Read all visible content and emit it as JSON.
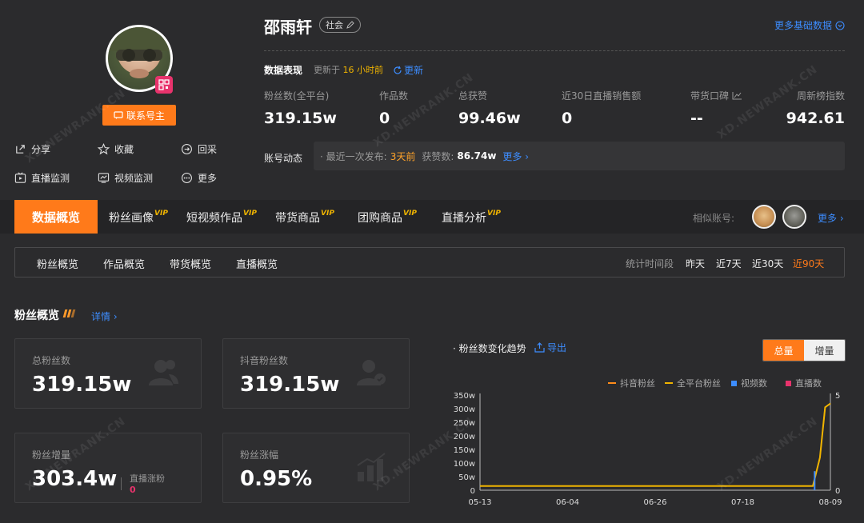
{
  "profile": {
    "name": "邵雨轩",
    "tag": "社会",
    "contact_label": "联系号主",
    "more_basic": "更多基础数据",
    "actions": [
      "分享",
      "收藏",
      "回采",
      "直播监测",
      "视频监测",
      "更多"
    ]
  },
  "performance": {
    "label": "数据表现",
    "updated_prefix": "更新于",
    "updated_time": "16 小时前",
    "refresh": "更新",
    "stats": [
      {
        "label": "粉丝数(全平台)",
        "value": "319.15w"
      },
      {
        "label": "作品数",
        "value": "0"
      },
      {
        "label": "总获赞",
        "value": "99.46w"
      },
      {
        "label": "近30日直播销售额",
        "value": "0"
      },
      {
        "label": "带货口碑",
        "value": "--"
      },
      {
        "label": "周新榜指数",
        "value": "942.61"
      }
    ]
  },
  "dynamics": {
    "label": "账号动态",
    "last_publish_label": "· 最近一次发布:",
    "last_publish": "3天前",
    "likes_label": "获赞数:",
    "likes": "86.74w",
    "more": "更多 ›"
  },
  "tabs": {
    "active": "数据概览",
    "items": [
      {
        "label": "粉丝画像",
        "vip": "VIP"
      },
      {
        "label": "短视频作品",
        "vip": "VIP"
      },
      {
        "label": "带货商品",
        "vip": "VIP"
      },
      {
        "label": "团购商品",
        "vip": "VIP"
      },
      {
        "label": "直播分析",
        "vip": "VIP"
      }
    ],
    "similar_label": "相似账号:",
    "more": "更多 ›"
  },
  "subnav": {
    "items": [
      "粉丝概览",
      "作品概览",
      "带货概览",
      "直播概览"
    ],
    "period_label": "统计时间段",
    "periods": [
      "昨天",
      "近7天",
      "近30天",
      "近90天"
    ],
    "active_period": "近90天"
  },
  "fans": {
    "title": "粉丝概览",
    "detail": "详情 ›",
    "cards": [
      {
        "label": "总粉丝数",
        "value": "319.15w"
      },
      {
        "label": "抖音粉丝数",
        "value": "319.15w"
      },
      {
        "label": "粉丝增量",
        "value": "303.4w",
        "sub_label": "直播涨粉",
        "sub_value": "0"
      },
      {
        "label": "粉丝涨幅",
        "value": "0.95%"
      }
    ]
  },
  "trend": {
    "title": "· 粉丝数变化趋势",
    "export": "导出",
    "toggle": [
      "总量",
      "增量"
    ],
    "legend": [
      {
        "name": "抖音粉丝",
        "color": "#ff8c1a"
      },
      {
        "name": "全平台粉丝",
        "color": "#f0b400"
      },
      {
        "name": "视频数",
        "color": "#3d8dff"
      },
      {
        "name": "直播数",
        "color": "#e8336c"
      }
    ]
  },
  "watermark": "XD.NEWRANK.CN",
  "chart_data": {
    "type": "line",
    "x_ticks": [
      "05-13",
      "06-04",
      "06-26",
      "07-18",
      "08-09"
    ],
    "y_ticks_left": [
      "0",
      "50w",
      "100w",
      "150w",
      "200w",
      "250w",
      "300w",
      "350w"
    ],
    "y_ticks_right": [
      "0",
      "5"
    ],
    "ylim_left": [
      0,
      350
    ],
    "ylim_right": [
      0,
      5
    ],
    "series": [
      {
        "name": "抖音粉丝",
        "color": "#ff8c1a",
        "x": [
          0,
          0.95,
          0.97,
          0.985,
          1.0
        ],
        "values": [
          15.7,
          15.7,
          120,
          305,
          319.15
        ]
      },
      {
        "name": "全平台粉丝",
        "color": "#f0b400",
        "x": [
          0,
          0.95,
          0.97,
          0.985,
          1.0
        ],
        "values": [
          15.7,
          15.7,
          120,
          305,
          319.15
        ]
      },
      {
        "name": "视频数",
        "color": "#3d8dff",
        "x": [
          0.955
        ],
        "values": [
          1
        ]
      }
    ]
  }
}
